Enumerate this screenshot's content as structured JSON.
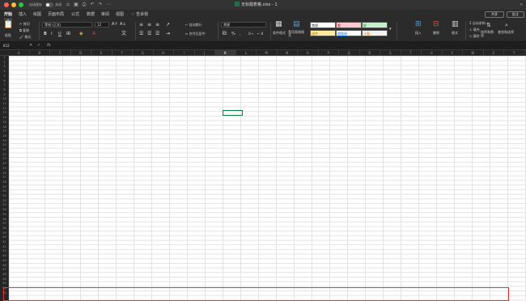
{
  "titlebar": {
    "autosave_label": "自动保存",
    "autosave_state": "关闭",
    "document_title": "无标题表格.xlsx - 1",
    "search_icon": "search-icon"
  },
  "tabs": [
    {
      "label": "开始",
      "active": true
    },
    {
      "label": "插入"
    },
    {
      "label": "绘图"
    },
    {
      "label": "页面布局"
    },
    {
      "label": "公式"
    },
    {
      "label": "数据"
    },
    {
      "label": "审阅"
    },
    {
      "label": "视图"
    },
    {
      "label": "告诉我"
    }
  ],
  "actions": {
    "share": "共享",
    "comments": "批注"
  },
  "ribbon": {
    "paste": "粘贴",
    "cut": "剪切",
    "copy": "复制",
    "format_painter": "格式",
    "font_name": "等线 (正文)",
    "font_size": "12",
    "bold": "B",
    "italic": "I",
    "underline": "U",
    "wrap_text": "自动换行",
    "merge_center": "合并后居中",
    "number_format": "常规",
    "percent": "%",
    "comma": ",",
    "conditional_format": "条件格式",
    "format_as_table": "套用表格格式",
    "cell_styles": {
      "normal": "常规",
      "bad": "差",
      "good": "好",
      "neutral": "适中",
      "hyperlink": "超链接",
      "calc": "计算"
    },
    "insert": "插入",
    "delete": "删除",
    "format": "格式",
    "autosum": "自动求和",
    "fill": "填充",
    "clear": "清除",
    "sort_filter": "排序和筛选",
    "find_select": "查找和选择"
  },
  "formula_bar": {
    "name_box": "K12",
    "fx": "fx",
    "value": ""
  },
  "columns": [
    "A",
    "B",
    "C",
    "D",
    "E",
    "F",
    "G",
    "H",
    "I",
    "J",
    "K",
    "L",
    "M",
    "N",
    "O",
    "P",
    "Q",
    "R",
    "S",
    "T",
    "U",
    "V",
    "W",
    "X",
    "Y"
  ],
  "active_column": "K",
  "rows_count": 52,
  "active_cell": "K12"
}
